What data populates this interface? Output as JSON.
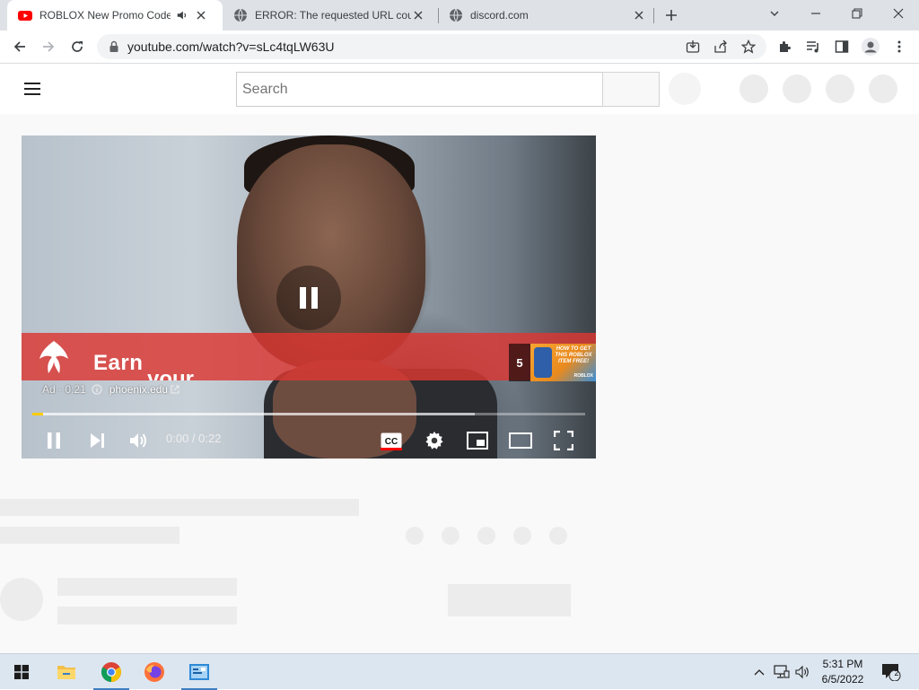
{
  "browser": {
    "tabs": [
      {
        "title": "ROBLOX New Promo Code!",
        "favicon": "youtube-icon",
        "active": true,
        "audio": true
      },
      {
        "title": "ERROR: The requested URL could not be retrieved",
        "favicon": "globe-icon",
        "active": false
      },
      {
        "title": "discord.com",
        "favicon": "globe-icon",
        "active": false
      }
    ],
    "url": "youtube.com/watch?v=sLc4tqLW63U"
  },
  "youtube": {
    "search_placeholder": "Search"
  },
  "player": {
    "ad": {
      "headline": "Earn",
      "headline2": "your",
      "label": "Ad · 0:21",
      "domain": "phoenix.edu",
      "countdown": "5",
      "thumb_text": "HOW TO GET THIS ROBLOX ITEM FREE!",
      "thumb_brand": "ROBLOX"
    },
    "time": "0:00 / 0:22",
    "progress": 0.02,
    "buffered": 0.8,
    "colors": {
      "progress": "#ffcc00",
      "ad_banner": "#dc3732",
      "cc_active": "#ff0000"
    }
  },
  "taskbar": {
    "apps": [
      "start-icon",
      "file-explorer-icon",
      "chrome-icon",
      "firefox-icon",
      "control-panel-icon"
    ],
    "time": "5:31 PM",
    "date": "6/5/2022",
    "notifications": "2"
  }
}
